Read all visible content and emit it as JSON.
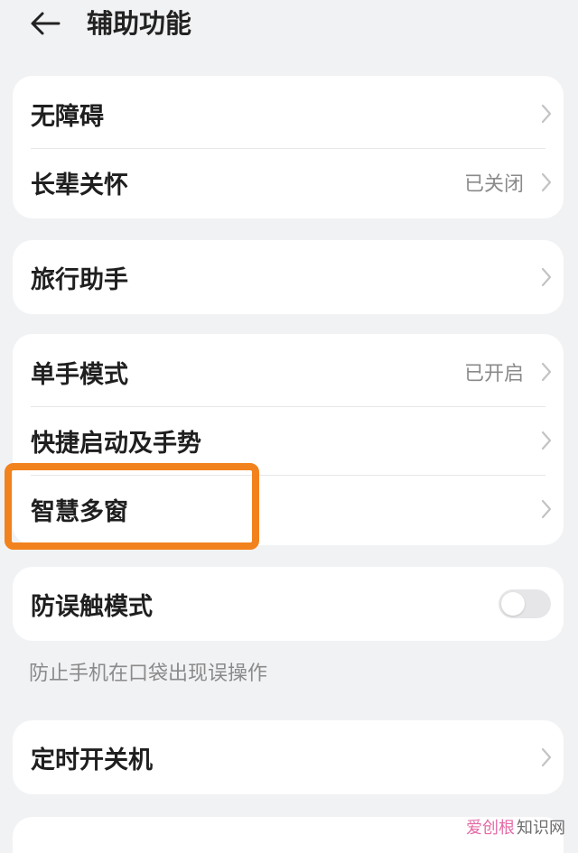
{
  "header": {
    "title": "辅助功能",
    "back_icon": "arrow-left-icon"
  },
  "groups": [
    {
      "items": [
        {
          "label": "无障碍",
          "value": ""
        },
        {
          "label": "长辈关怀",
          "value": "已关闭"
        }
      ]
    },
    {
      "items": [
        {
          "label": "旅行助手",
          "value": ""
        }
      ]
    },
    {
      "items": [
        {
          "label": "单手模式",
          "value": "已开启"
        },
        {
          "label": "快捷启动及手势",
          "value": ""
        },
        {
          "label": "智慧多窗",
          "value": ""
        }
      ]
    },
    {
      "items": [
        {
          "label": "防误触模式",
          "toggle": false
        }
      ]
    },
    {
      "items": [
        {
          "label": "定时开关机",
          "value": ""
        }
      ]
    }
  ],
  "caption": "防止手机在口袋出现误操作",
  "highlight_color": "#f2821e",
  "watermark": {
    "part1": "爱创根",
    "part2": "知识网"
  }
}
